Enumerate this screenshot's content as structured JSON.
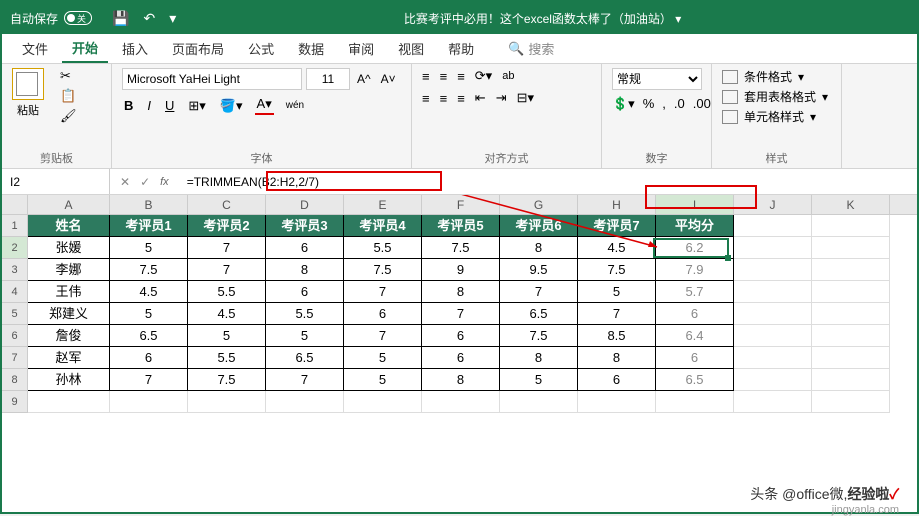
{
  "titlebar": {
    "autosave_label": "自动保存",
    "autosave_state": "关",
    "doc_title": "比赛考评中必用！这个excel函数太棒了（加油站）"
  },
  "menu": {
    "file": "文件",
    "home": "开始",
    "insert": "插入",
    "layout": "页面布局",
    "formula": "公式",
    "data": "数据",
    "review": "审阅",
    "view": "视图",
    "help": "帮助",
    "search": "搜索"
  },
  "ribbon": {
    "clipboard": {
      "paste": "粘贴",
      "label": "剪贴板"
    },
    "font": {
      "name": "Microsoft YaHei Light",
      "size": "11",
      "label": "字体",
      "bold": "B",
      "italic": "I",
      "underline": "U",
      "wen": "wén"
    },
    "align": {
      "label": "对齐方式",
      "wrap": "ab"
    },
    "number": {
      "format": "常规",
      "label": "数字"
    },
    "styles": {
      "cond": "条件格式",
      "table": "套用表格格式",
      "cell": "单元格样式",
      "label": "样式"
    }
  },
  "formulabar": {
    "name": "I2",
    "formula": "=TRIMMEAN(B2:H2,2/7)"
  },
  "columns": [
    "A",
    "B",
    "C",
    "D",
    "E",
    "F",
    "G",
    "H",
    "I",
    "J",
    "K"
  ],
  "chart_data": {
    "type": "table",
    "headers": [
      "姓名",
      "考评员1",
      "考评员2",
      "考评员3",
      "考评员4",
      "考评员5",
      "考评员6",
      "考评员7",
      "平均分"
    ],
    "rows": [
      {
        "name": "张媛",
        "v": [
          5,
          7,
          6,
          5.5,
          7.5,
          8,
          4.5
        ],
        "avg": 6.2
      },
      {
        "name": "李娜",
        "v": [
          7.5,
          7,
          8,
          7.5,
          9,
          9.5,
          7.5
        ],
        "avg": 7.9
      },
      {
        "name": "王伟",
        "v": [
          4.5,
          5.5,
          6,
          7,
          8,
          7,
          5
        ],
        "avg": 5.7
      },
      {
        "name": "郑建义",
        "v": [
          5,
          4.5,
          5.5,
          6,
          7,
          6.5,
          7
        ],
        "avg": 6
      },
      {
        "name": "詹俊",
        "v": [
          6.5,
          5,
          5,
          7,
          6,
          7.5,
          8.5
        ],
        "avg": 6.4
      },
      {
        "name": "赵军",
        "v": [
          6,
          5.5,
          6.5,
          5,
          6,
          8,
          8
        ],
        "avg": 6
      },
      {
        "name": "孙林",
        "v": [
          7,
          7.5,
          7,
          5,
          8,
          5,
          6
        ],
        "avg": 6.5
      }
    ]
  },
  "watermark": {
    "text": "头条 @office微,",
    "site": "jingyanla.com",
    "brand": "经验啦"
  }
}
